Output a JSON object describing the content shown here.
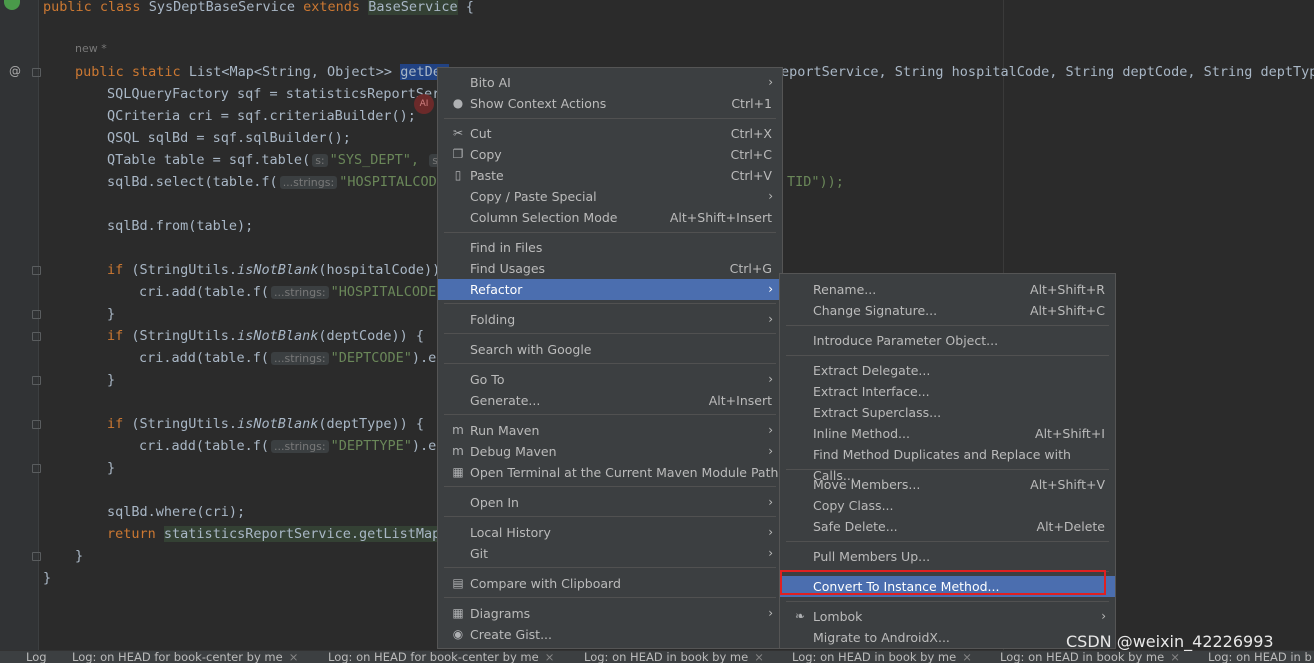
{
  "editor": {
    "new_hint": "new *",
    "line_class": {
      "kw1": "public",
      "kw2": "class",
      "name": "SysDeptBaseService",
      "kw3": "extends",
      "base": "BaseService",
      "brace": "{"
    },
    "line_method": {
      "kw1": "public",
      "kw2": "static",
      "type": "List<Map<String, Object>>",
      "name": "getDep",
      "rest": "eportService, String hospitalCode, String deptCode, String deptType"
    },
    "l1": "SQLQueryFactory sqf = statisticsReportServ",
    "l2": "QCriteria cri = sqf.criteriaBuilder();",
    "l3": "QSQL sqlBd = sqf.sqlBuilder();",
    "l4_a": "QTable table = sqf.table(",
    "l4_hint": "s:",
    "l4_str": "\"SYS_DEPT\",",
    "l4_hint2": "s",
    "l5_a": "sqlBd.select(table.f(",
    "l5_hint": "...strings:",
    "l5_str": "\"HOSPITALCOD",
    "l5_tail": "TID\"));",
    "l6": "sqlBd.from(table);",
    "l7_kw": "if",
    "l7_a": " (StringUtils.",
    "l7_it": "isNotBlank",
    "l7_b": "(hospitalCode))",
    "l8_a": "cri.add(table.f(",
    "l8_hint": "...strings:",
    "l8_str": "\"HOSPITALCODE",
    "l9": "}",
    "l10_kw": "if",
    "l10_a": " (StringUtils.",
    "l10_it": "isNotBlank",
    "l10_b": "(deptCode)) {",
    "l11_a": "cri.add(table.f(",
    "l11_hint": "...strings:",
    "l11_str": "\"DEPTCODE\"",
    "l11_b": ").e",
    "l12": "}",
    "l13_kw": "if",
    "l13_a": " (StringUtils.",
    "l13_it": "isNotBlank",
    "l13_b": "(deptType)) {",
    "l14_a": "cri.add(table.f(",
    "l14_hint": "...strings:",
    "l14_str": "\"DEPTTYPE\"",
    "l14_b": ").e",
    "l15": "}",
    "l16": "sqlBd.where(cri);",
    "l17_kw": "return",
    "l17_a": "statisticsReportService.getListMap",
    "l18": "}",
    "l19": "}",
    "gutter_at": "@",
    "ai_badge": "AI"
  },
  "context_menu": {
    "items": [
      {
        "label": "Bito AI",
        "shortcut": "",
        "submenu": true,
        "icon": ""
      },
      {
        "label": "Show Context Actions",
        "shortcut": "Ctrl+1",
        "submenu": false,
        "icon": "lightbulb-icon"
      },
      {
        "label": "Cut",
        "shortcut": "Ctrl+X",
        "submenu": false,
        "icon": "scissors-icon"
      },
      {
        "label": "Copy",
        "shortcut": "Ctrl+C",
        "submenu": false,
        "icon": "copy-icon"
      },
      {
        "label": "Paste",
        "shortcut": "Ctrl+V",
        "submenu": false,
        "icon": "clipboard-icon"
      },
      {
        "label": "Copy / Paste Special",
        "shortcut": "",
        "submenu": true,
        "icon": ""
      },
      {
        "label": "Column Selection Mode",
        "shortcut": "Alt+Shift+Insert",
        "submenu": false,
        "icon": ""
      },
      {
        "label": "Find in Files",
        "shortcut": "",
        "submenu": false,
        "icon": ""
      },
      {
        "label": "Find Usages",
        "shortcut": "Ctrl+G",
        "submenu": false,
        "icon": ""
      },
      {
        "label": "Refactor",
        "shortcut": "",
        "submenu": true,
        "icon": "",
        "active": true
      },
      {
        "label": "Folding",
        "shortcut": "",
        "submenu": true,
        "icon": ""
      },
      {
        "label": "Search with Google",
        "shortcut": "",
        "submenu": false,
        "icon": ""
      },
      {
        "label": "Go To",
        "shortcut": "",
        "submenu": true,
        "icon": ""
      },
      {
        "label": "Generate...",
        "shortcut": "Alt+Insert",
        "submenu": false,
        "icon": ""
      },
      {
        "label": "Run Maven",
        "shortcut": "",
        "submenu": true,
        "icon": "maven-icon"
      },
      {
        "label": "Debug Maven",
        "shortcut": "",
        "submenu": true,
        "icon": "maven-icon"
      },
      {
        "label": "Open Terminal at the Current Maven Module Path",
        "shortcut": "",
        "submenu": false,
        "icon": "terminal-icon"
      },
      {
        "label": "Open In",
        "shortcut": "",
        "submenu": true,
        "icon": ""
      },
      {
        "label": "Local History",
        "shortcut": "",
        "submenu": true,
        "icon": ""
      },
      {
        "label": "Git",
        "shortcut": "",
        "submenu": true,
        "icon": ""
      },
      {
        "label": "Compare with Clipboard",
        "shortcut": "",
        "submenu": false,
        "icon": "compare-icon"
      },
      {
        "label": "Diagrams",
        "shortcut": "",
        "submenu": true,
        "icon": "diagram-icon"
      },
      {
        "label": "Create Gist...",
        "shortcut": "",
        "submenu": false,
        "icon": "github-icon"
      }
    ]
  },
  "refactor_menu": {
    "items": [
      {
        "label": "Rename...",
        "shortcut": "Alt+Shift+R",
        "submenu": false
      },
      {
        "label": "Change Signature...",
        "shortcut": "Alt+Shift+C",
        "submenu": false
      },
      {
        "label": "Introduce Parameter Object...",
        "shortcut": "",
        "submenu": false
      },
      {
        "label": "Extract Delegate...",
        "shortcut": "",
        "submenu": false
      },
      {
        "label": "Extract Interface...",
        "shortcut": "",
        "submenu": false
      },
      {
        "label": "Extract Superclass...",
        "shortcut": "",
        "submenu": false
      },
      {
        "label": "Inline Method...",
        "shortcut": "Alt+Shift+I",
        "submenu": false
      },
      {
        "label": "Find Method Duplicates and Replace with Calls...",
        "shortcut": "",
        "submenu": false
      },
      {
        "label": "Move Members...",
        "shortcut": "Alt+Shift+V",
        "submenu": false
      },
      {
        "label": "Copy Class...",
        "shortcut": "",
        "submenu": false
      },
      {
        "label": "Safe Delete...",
        "shortcut": "Alt+Delete",
        "submenu": false
      },
      {
        "label": "Pull Members Up...",
        "shortcut": "",
        "submenu": false
      },
      {
        "label": "Convert To Instance Method...",
        "shortcut": "",
        "submenu": false,
        "active": true
      },
      {
        "label": "Lombok",
        "shortcut": "",
        "submenu": true,
        "icon": "chili-icon"
      },
      {
        "label": "Migrate to AndroidX...",
        "shortcut": "",
        "submenu": false
      }
    ]
  },
  "bottom_tabs": [
    "Log",
    "Log: on HEAD for book-center by me",
    "Log: on HEAD for book-center by me",
    "Log: on HEAD in book by me",
    "Log: on HEAD in book by me",
    "Log: on HEAD in book by me",
    "Log: on HEAD in b"
  ],
  "watermark": "CSDN @weixin_42226993",
  "colors": {
    "accent": "#4b6eaf",
    "highlight_box": "#e02020",
    "editor_bg": "#2b2b2b",
    "menu_bg": "#3c3f41"
  }
}
